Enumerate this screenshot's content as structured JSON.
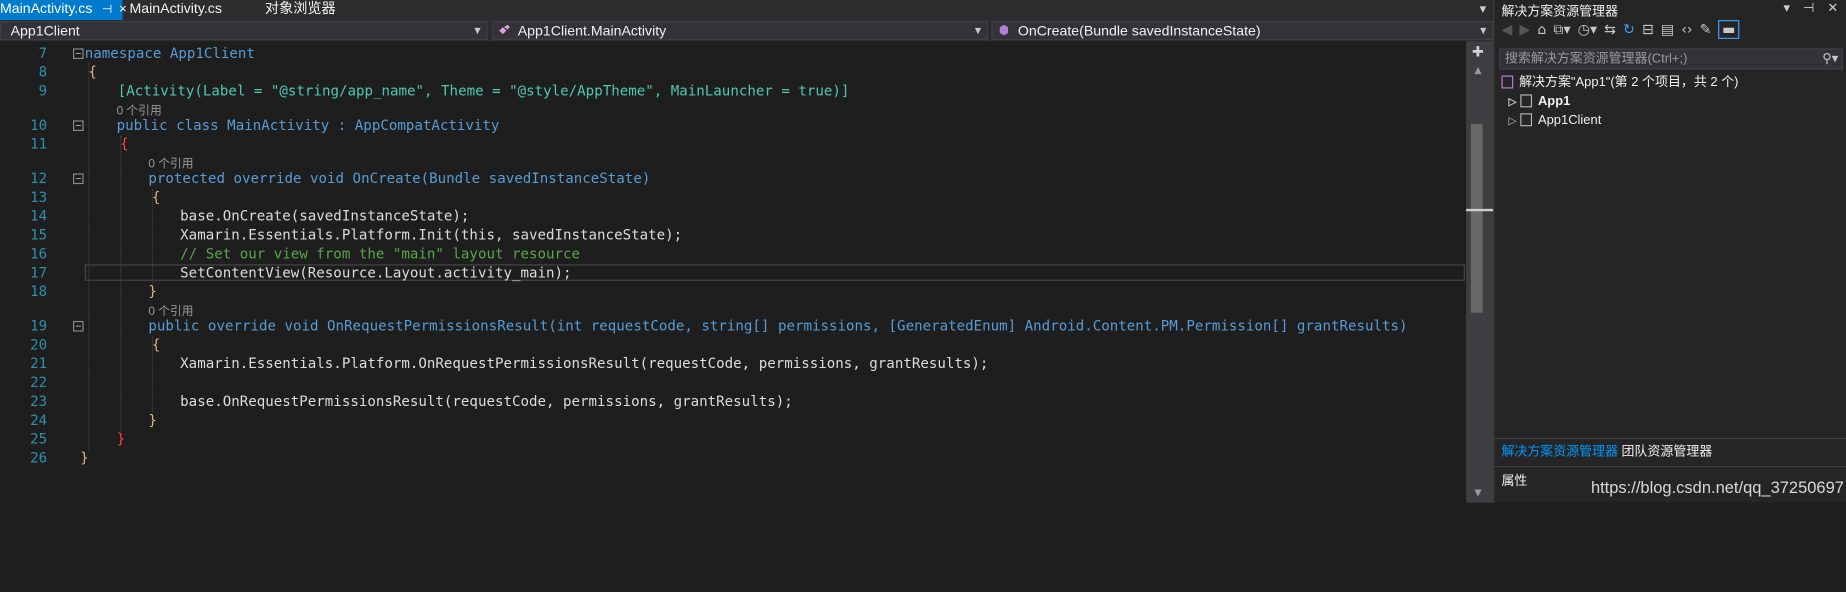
{
  "tabs": [
    {
      "label": "MainActivity.cs",
      "active": true,
      "pin": "⊣",
      "close": "×"
    },
    {
      "label": "MainActivity.cs",
      "active": false
    },
    {
      "label": "对象浏览器",
      "active": false
    }
  ],
  "tab_menu_icon": "chevron-down-icon",
  "nav": {
    "project": "App1Client",
    "class": "App1Client.MainActivity",
    "member": "OnCreate(Bundle savedInstanceState)"
  },
  "line_numbers": [
    "7",
    "8",
    "9",
    "10",
    "11",
    "12",
    "13",
    "14",
    "15",
    "16",
    "17",
    "18",
    "19",
    "20",
    "21",
    "22",
    "23",
    "24",
    "25",
    "26"
  ],
  "ref_labels": [
    "0 个引用",
    "0 个引用",
    "0 个引用"
  ],
  "code_lines": [
    "namespace App1Client",
    "{",
    "[Activity(Label = \"@string/app_name\", Theme = \"@style/AppTheme\", MainLauncher = true)]",
    "public class MainActivity : AppCompatActivity",
    "{",
    "protected override void OnCreate(Bundle savedInstanceState)",
    "{",
    "base.OnCreate(savedInstanceState);",
    "Xamarin.Essentials.Platform.Init(this, savedInstanceState);",
    "// Set our view from the \"main\" layout resource",
    "SetContentView(Resource.Layout.activity_main);",
    "}",
    "public override void OnRequestPermissionsResult(int requestCode, string[] permissions, [GeneratedEnum] Android.Content.PM.Permission[] grantResults)",
    "{",
    "Xamarin.Essentials.Platform.OnRequestPermissionsResult(requestCode, permissions, grantResults);",
    "",
    "base.OnRequestPermissionsResult(requestCode, permissions, grantResults);",
    "}",
    "}",
    "}"
  ],
  "solution_explorer": {
    "title": "解决方案资源管理器",
    "controls": "▾ ⊣ ✕",
    "search_placeholder": "搜索解决方案资源管理器(Ctrl+;)",
    "solution_label": "解决方案\"App1\"(第 2 个项目，共 2 个)",
    "projects": [
      {
        "name": "App1",
        "bold": true
      },
      {
        "name": "App1Client",
        "bold": false
      }
    ],
    "tabs": [
      "解决方案资源管理器",
      "团队资源管理器"
    ],
    "properties_title": "属性"
  },
  "watermark": "https://blog.csdn.net/qq_37250697",
  "colors": {
    "accent": "#007acc",
    "keyword": "#569cd6",
    "type": "#4ec9b0",
    "string": "#d69d85",
    "comment": "#57a64a",
    "line_number": "#2b91af"
  }
}
